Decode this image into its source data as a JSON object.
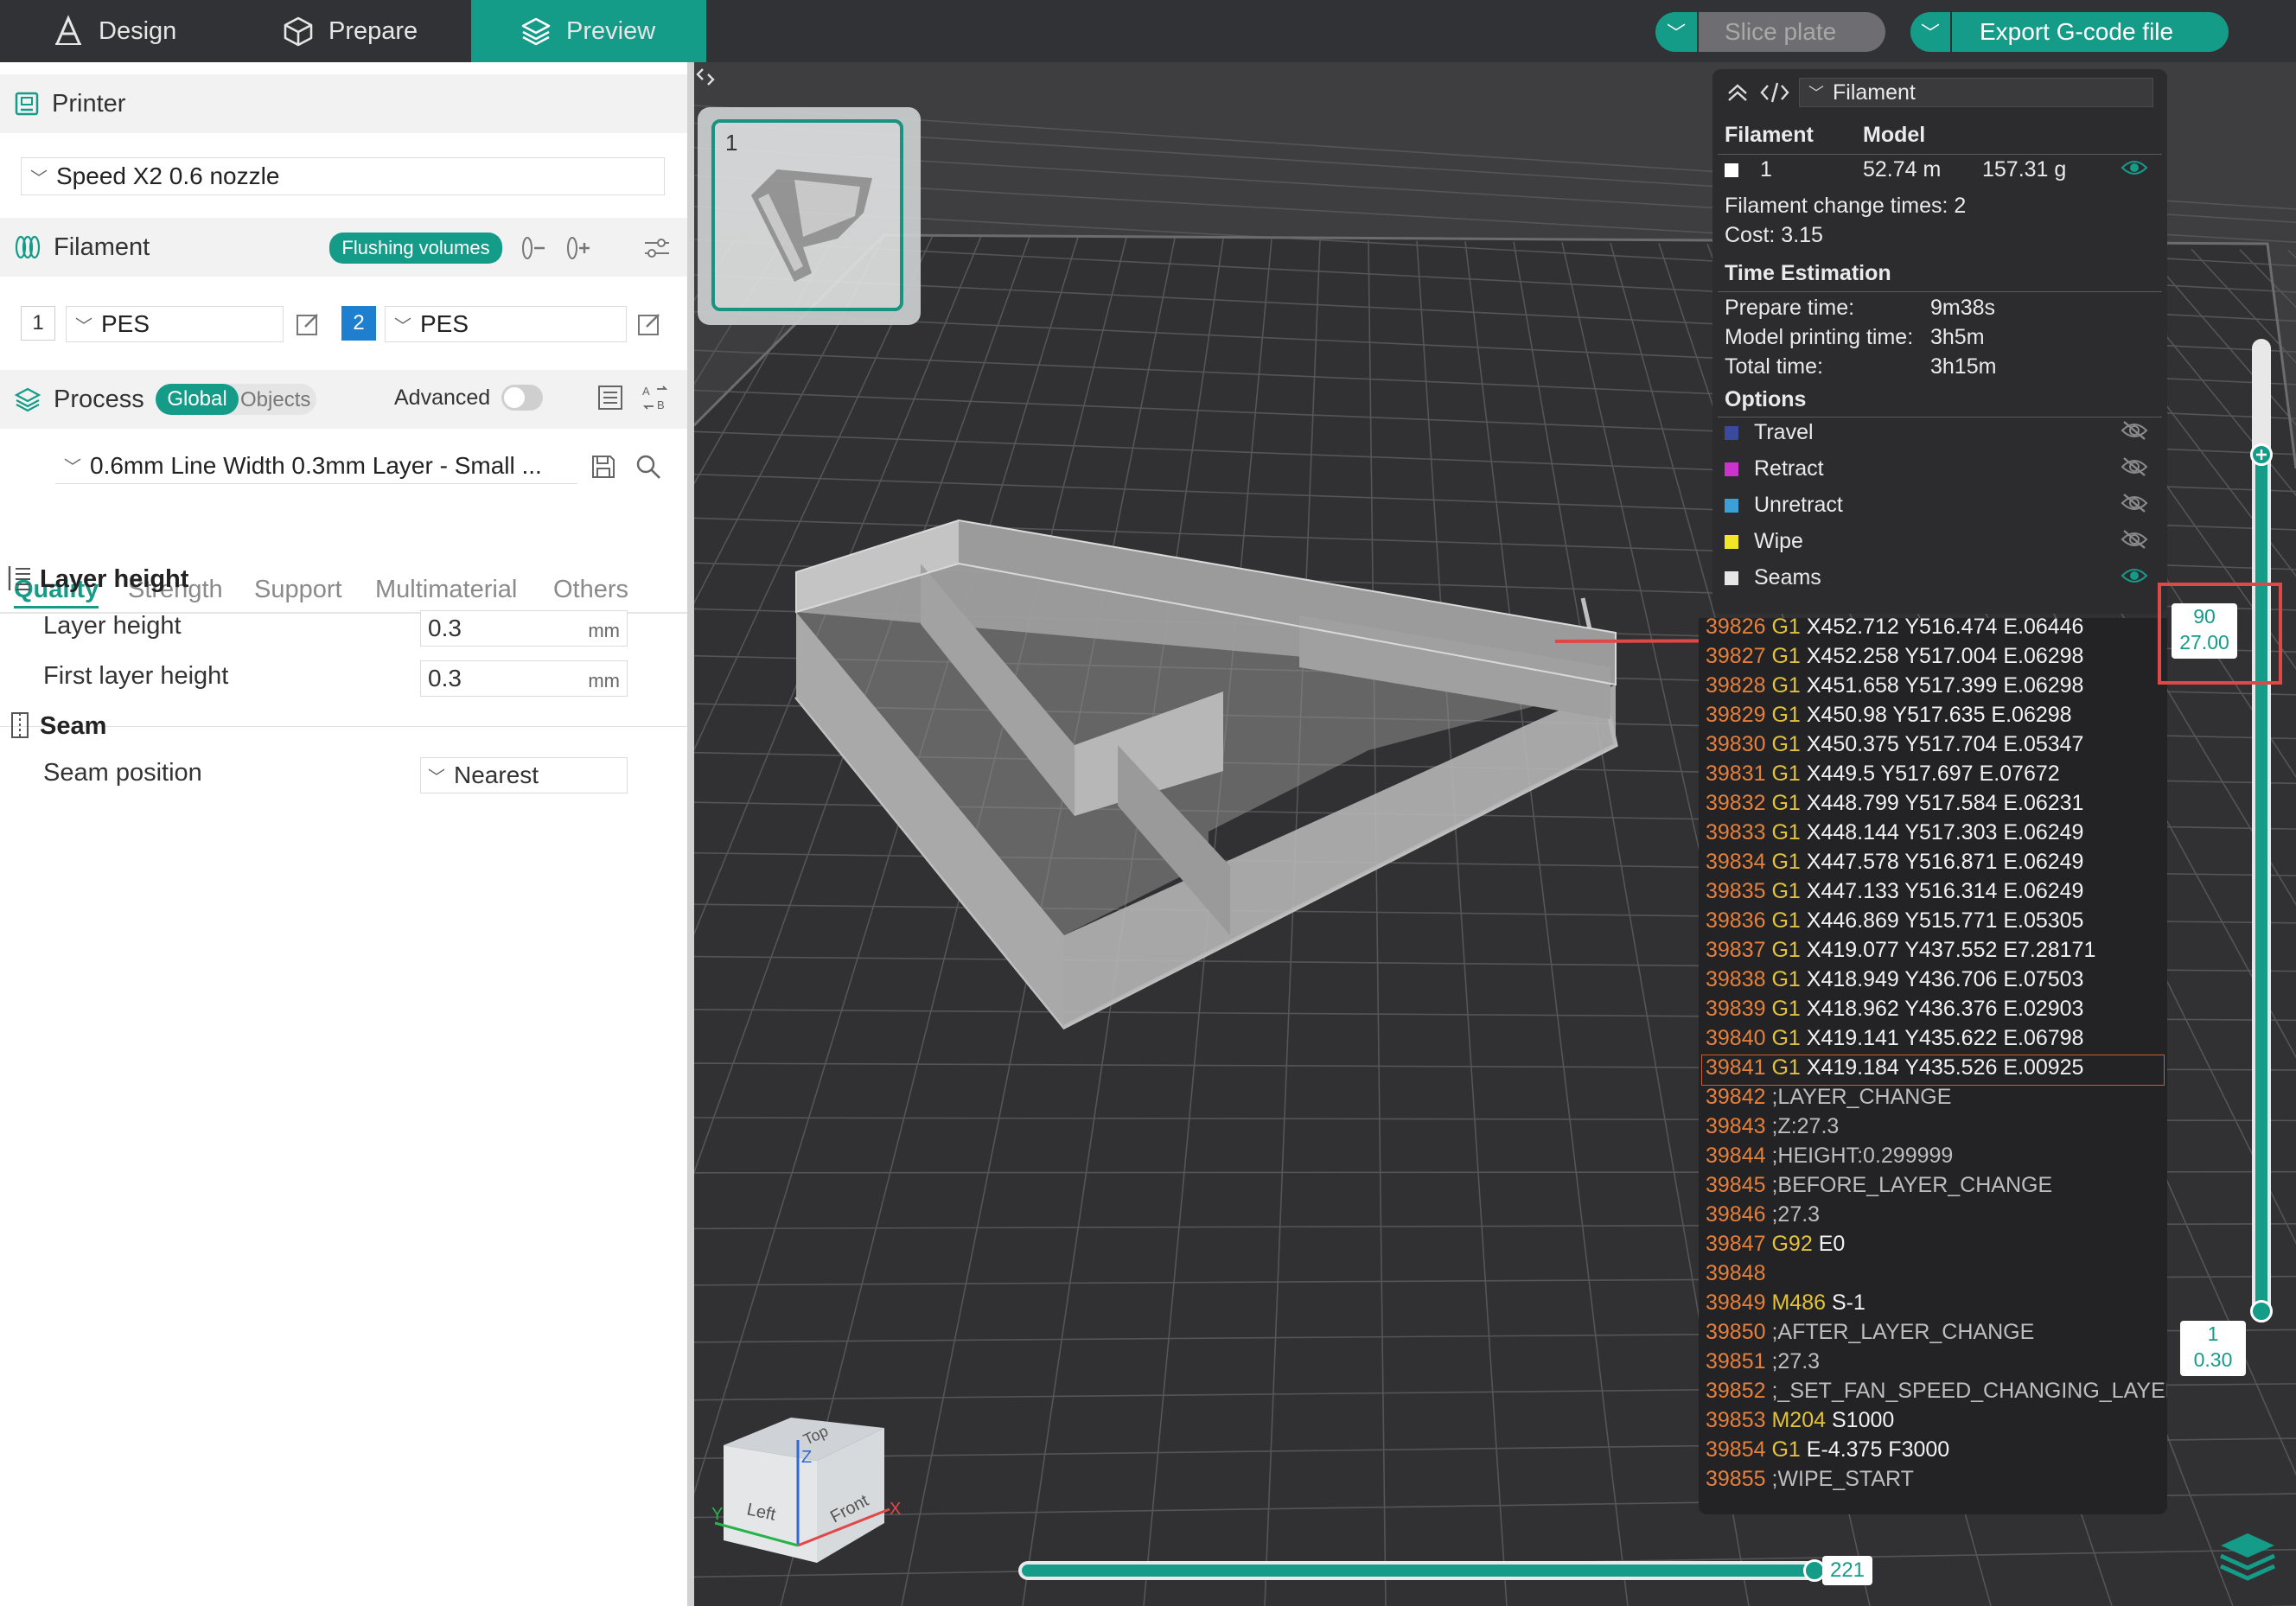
{
  "topbar": {
    "tabs": [
      {
        "label": "Design"
      },
      {
        "label": "Prepare"
      },
      {
        "label": "Preview"
      }
    ],
    "slice_label": "Slice plate",
    "export_label": "Export G-code file"
  },
  "printer": {
    "title": "Printer",
    "selected": "Speed X2 0.6 nozzle"
  },
  "filament": {
    "title": "Filament",
    "flush_label": "Flushing volumes",
    "slots": [
      {
        "index": "1",
        "type": "PES"
      },
      {
        "index": "2",
        "type": "PES"
      }
    ]
  },
  "process": {
    "title": "Process",
    "global_label": "Global",
    "objects_label": "Objects",
    "advanced_label": "Advanced",
    "preset": "0.6mm Line Width 0.3mm Layer - Small ..."
  },
  "tabs": [
    "Quality",
    "Strength",
    "Support",
    "Multimaterial",
    "Others"
  ],
  "groups": {
    "layer_height_title": "Layer height",
    "layer_height_label": "Layer height",
    "layer_height_value": "0.3",
    "first_layer_label": "First layer height",
    "first_layer_value": "0.3",
    "unit": "mm",
    "seam_title": "Seam",
    "seam_position_label": "Seam position",
    "seam_position_value": "Nearest"
  },
  "plate": {
    "number": "1"
  },
  "legend": {
    "view_label": "Filament",
    "col_filament": "Filament",
    "col_model": "Model",
    "row_index": "1",
    "length": "52.74 m",
    "weight": "157.31 g",
    "change_times": "Filament change times: 2",
    "cost": "Cost: 3.15",
    "time_title": "Time Estimation",
    "prepare_label": "Prepare time:",
    "prepare_value": "9m38s",
    "model_label": "Model printing time:",
    "model_value": "3h5m",
    "total_label": "Total time:",
    "total_value": "3h15m",
    "options_title": "Options",
    "options": [
      {
        "label": "Travel",
        "color": "#3a4a9c",
        "visible": false
      },
      {
        "label": "Retract",
        "color": "#cc33cc",
        "visible": false
      },
      {
        "label": "Unretract",
        "color": "#3ca0d8",
        "visible": false
      },
      {
        "label": "Wipe",
        "color": "#f2e626",
        "visible": false
      },
      {
        "label": "Seams",
        "color": "#e6e6e6",
        "visible": true
      }
    ]
  },
  "gcode": [
    {
      "num": "39826",
      "cmd": "G1",
      "args": "X452.712 Y516.474 E.06446",
      "comment": ""
    },
    {
      "num": "39827",
      "cmd": "G1",
      "args": "X452.258 Y517.004 E.06298",
      "comment": ""
    },
    {
      "num": "39828",
      "cmd": "G1",
      "args": "X451.658 Y517.399 E.06298",
      "comment": ""
    },
    {
      "num": "39829",
      "cmd": "G1",
      "args": "X450.98 Y517.635 E.06298",
      "comment": ""
    },
    {
      "num": "39830",
      "cmd": "G1",
      "args": "X450.375 Y517.704 E.05347",
      "comment": ""
    },
    {
      "num": "39831",
      "cmd": "G1",
      "args": "X449.5 Y517.697 E.07672",
      "comment": ""
    },
    {
      "num": "39832",
      "cmd": "G1",
      "args": "X448.799 Y517.584 E.06231",
      "comment": ""
    },
    {
      "num": "39833",
      "cmd": "G1",
      "args": "X448.144 Y517.303 E.06249",
      "comment": ""
    },
    {
      "num": "39834",
      "cmd": "G1",
      "args": "X447.578 Y516.871 E.06249",
      "comment": ""
    },
    {
      "num": "39835",
      "cmd": "G1",
      "args": "X447.133 Y516.314 E.06249",
      "comment": ""
    },
    {
      "num": "39836",
      "cmd": "G1",
      "args": "X446.869 Y515.771 E.05305",
      "comment": ""
    },
    {
      "num": "39837",
      "cmd": "G1",
      "args": "X419.077 Y437.552 E7.28171",
      "comment": ""
    },
    {
      "num": "39838",
      "cmd": "G1",
      "args": "X418.949 Y436.706 E.07503",
      "comment": ""
    },
    {
      "num": "39839",
      "cmd": "G1",
      "args": "X418.962 Y436.376 E.02903",
      "comment": ""
    },
    {
      "num": "39840",
      "cmd": "G1",
      "args": "X419.141 Y435.622 E.06798",
      "comment": ""
    },
    {
      "num": "39841",
      "cmd": "G1",
      "args": "X419.184 Y435.526 E.00925",
      "comment": ""
    },
    {
      "num": "39842",
      "cmd": "",
      "args": "",
      "comment": ";LAYER_CHANGE"
    },
    {
      "num": "39843",
      "cmd": "",
      "args": "",
      "comment": ";Z:27.3"
    },
    {
      "num": "39844",
      "cmd": "",
      "args": "",
      "comment": ";HEIGHT:0.299999"
    },
    {
      "num": "39845",
      "cmd": "",
      "args": "",
      "comment": ";BEFORE_LAYER_CHANGE"
    },
    {
      "num": "39846",
      "cmd": "",
      "args": "",
      "comment": ";27.3"
    },
    {
      "num": "39847",
      "cmd": "G92",
      "args": "E0",
      "comment": ""
    },
    {
      "num": "39848",
      "cmd": "",
      "args": "",
      "comment": ""
    },
    {
      "num": "39849",
      "cmd": "M486",
      "args": "S-1",
      "comment": ""
    },
    {
      "num": "39850",
      "cmd": "",
      "args": "",
      "comment": ";AFTER_LAYER_CHANGE"
    },
    {
      "num": "39851",
      "cmd": "",
      "args": "",
      "comment": ";27.3"
    },
    {
      "num": "39852",
      "cmd": "",
      "args": "",
      "comment": ";_SET_FAN_SPEED_CHANGING_LAYER"
    },
    {
      "num": "39853",
      "cmd": "M204",
      "args": "S1000",
      "comment": ""
    },
    {
      "num": "39854",
      "cmd": "G1",
      "args": "E-4.375 F3000",
      "comment": ""
    },
    {
      "num": "39855",
      "cmd": "",
      "args": "",
      "comment": ";WIPE_START"
    }
  ],
  "layer_slider": {
    "top_layer": "90",
    "top_height": "27.00",
    "bottom_layer": "1",
    "bottom_height": "0.30",
    "top_fraction": 0.89
  },
  "move_slider": {
    "value": "221",
    "fraction": 1.0
  },
  "view_cube": {
    "top": "Top",
    "left": "Left",
    "front": "Front",
    "z": "Z",
    "x": "X",
    "y": "Y"
  },
  "colors": {
    "accent": "#159c89",
    "highlight_red": "#e04848"
  }
}
